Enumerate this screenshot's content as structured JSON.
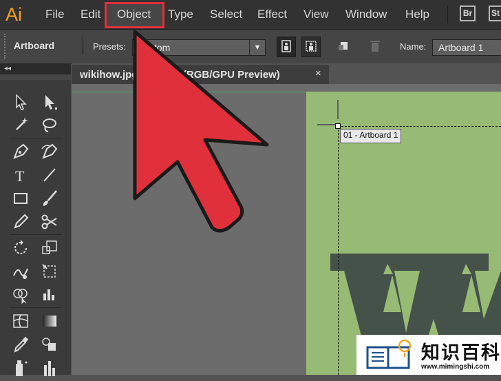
{
  "app": {
    "logo": "Ai"
  },
  "menu": {
    "items": [
      "File",
      "Edit",
      "Object",
      "Type",
      "Select",
      "Effect",
      "View",
      "Window",
      "Help"
    ],
    "highlighted": "Object",
    "bridge_icon": "Br",
    "stock_icon": "St"
  },
  "control_bar": {
    "artboard_label": "Artboard",
    "presets_label": "Presets:",
    "presets_value": "Custom",
    "name_label": "Name:",
    "name_value": "Artboard 1"
  },
  "tools_panel": {
    "collapse_glyph": "◂◂"
  },
  "document": {
    "tab_label": "wikihow.jpg @ 100% (RGB/GPU Preview)",
    "close_glyph": "×",
    "artboard_label": "01 - Artboard 1"
  },
  "overlay": {
    "arrow_color": "#e0303c",
    "highlight_color": "#e0303c"
  },
  "watermark": {
    "title": "知识百科",
    "url": "www.mimingshi.com"
  }
}
